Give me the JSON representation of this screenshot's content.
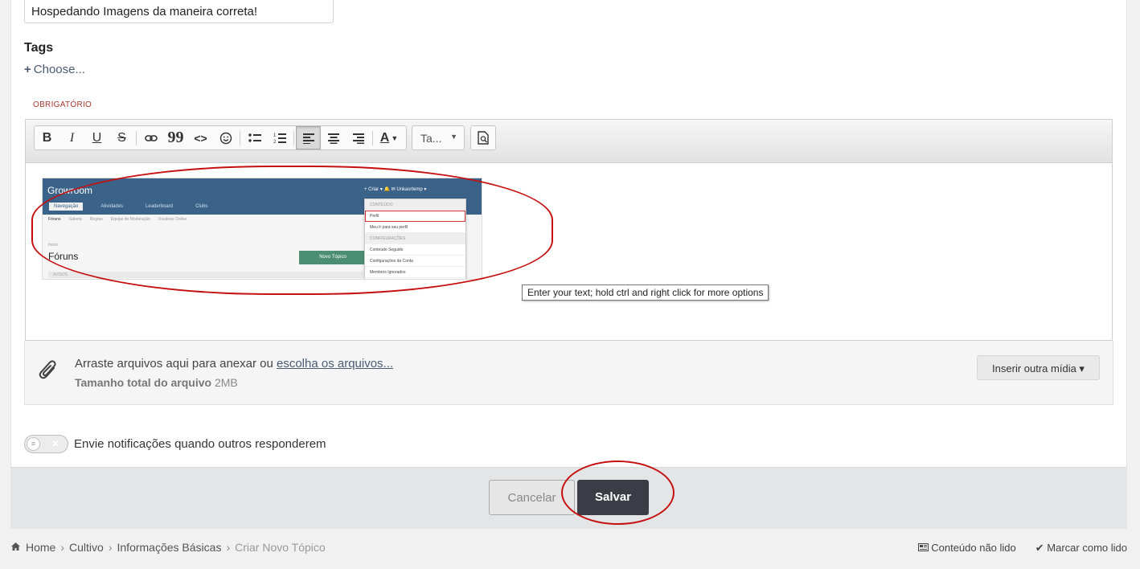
{
  "form": {
    "title_value": "Hospedando Imagens da maneira correta!",
    "tags_label": "Tags",
    "tags_choose": "Choose...",
    "required_label": "OBRIGATÓRIO"
  },
  "toolbar": {
    "bold": "B",
    "italic": "I",
    "underline": "U",
    "strike": "S",
    "link_icon": "link-icon",
    "quote": "99",
    "code": "<>",
    "emoji_icon": "smiley-icon",
    "font_color": "A",
    "style_select": "Ta...",
    "preview_icon": "preview-icon"
  },
  "embedded": {
    "logo": "Growroom",
    "tabs": [
      "Navegação",
      "Atividades",
      "Leaderboard",
      "Clubs"
    ],
    "topbar_right": "+ Criar ▾    🔔  ✉    Unkasrtemp ▾",
    "subnav": [
      "Fóruns",
      "Galeria",
      "Regras",
      "Equipe de Moderação",
      "Usuários Online"
    ],
    "crumb": "Início",
    "heading": "Fóruns",
    "new_topic": "Novo Tópico",
    "bar_label": "AVISOS",
    "menu": [
      "CONTEÚDO",
      "Perfil",
      "Meu Ir para seu perfil",
      "CONFIGURAÇÕES",
      "Conteúdo Seguido",
      "Configurações da Conta",
      "Membros Ignorados"
    ]
  },
  "tooltip": "Enter your text; hold ctrl and right click for more options",
  "attach": {
    "text_before": "Arraste arquivos aqui para anexar ou ",
    "link": "escolha os arquivos...",
    "size_label": "Tamanho total do arquivo",
    "size_value": "2MB",
    "other_media": "Inserir outra mídia ▾"
  },
  "notify": {
    "label": "Envie notificações quando outros responderem"
  },
  "actions": {
    "cancel": "Cancelar",
    "save": "Salvar"
  },
  "breadcrumb": {
    "items": [
      "Home",
      "Cultivo",
      "Informações Básicas"
    ],
    "current": "Criar Novo Tópico"
  },
  "links": {
    "unread": "Conteúdo não lido",
    "mark_read": "Marcar como lido"
  },
  "colors": {
    "primary_button": "#3a3d45",
    "annotation": "#c51010",
    "link": "#4a5a73"
  }
}
